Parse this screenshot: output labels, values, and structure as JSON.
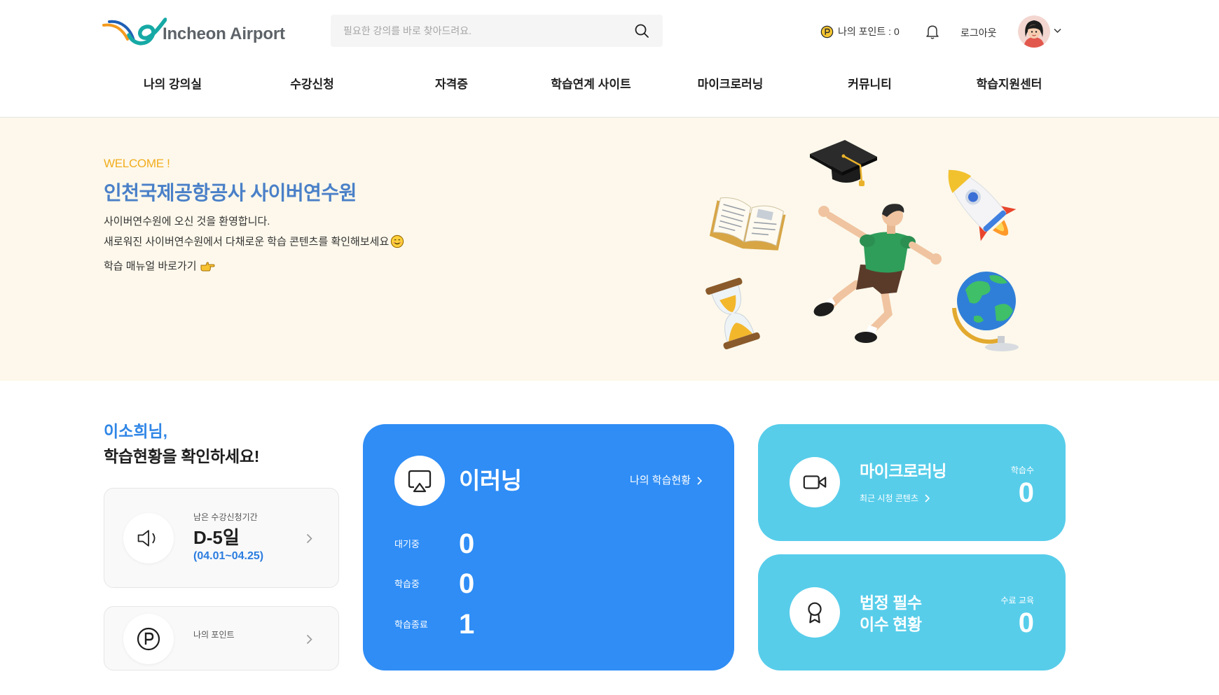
{
  "header": {
    "logo_text": "Incheon Airport",
    "search": {
      "placeholder": "필요한 강의를 바로 찾아드려요."
    },
    "points_label": "나의 포인트 : 0",
    "logout_label": "로그아웃"
  },
  "nav": {
    "items": [
      "나의 강의실",
      "수강신청",
      "자격증",
      "학습연계 사이트",
      "마이크로러닝",
      "커뮤니티",
      "학습지원센터"
    ]
  },
  "hero": {
    "welcome": "WELCOME !",
    "title": "인천국제공항공사 사이버연수원",
    "line1": "사이버연수원에 오신 것을 환영합니다.",
    "line2": "새로워진 사이버연수원에서 다채로운 학습 콘텐츠를 확인해보세요",
    "manual_link": "학습 매뉴얼 바로가기"
  },
  "status": {
    "greeting_name": "이소희님,",
    "greeting_text": "학습현황을 확인하세요!",
    "enrollment_period": {
      "label": "남은 수강신청기간",
      "dday": "D-5일",
      "range": "(04.01~04.25)"
    },
    "my_points": {
      "label": "나의 포인트"
    }
  },
  "elearning": {
    "title": "이러닝",
    "link": "나의 학습현황",
    "rows": [
      {
        "label": "대기중",
        "value": "0"
      },
      {
        "label": "학습중",
        "value": "0"
      },
      {
        "label": "학습종료",
        "value": "1"
      }
    ]
  },
  "microlearning": {
    "title": "마이크로러닝",
    "link": "최근 시청 콘텐츠",
    "stat_label": "학습수",
    "stat_value": "0"
  },
  "mandatory": {
    "title_line1": "법정 필수",
    "title_line2": "이수 현황",
    "stat_label": "수료 교육",
    "stat_value": "0"
  },
  "icons": {
    "logo": "incheon-airport-logo-icon",
    "search": "search-icon",
    "points": "point-coin-icon",
    "notifications": "bell-icon",
    "account_menu": "chevron-down-icon",
    "hero_emoji": "smile-emoji-icon",
    "manual_link": "pointing-hand-icon",
    "enrollment_period": "speaker-icon",
    "my_points": "point-circle-icon",
    "elearning": "airplay-icon",
    "microlearning": "video-camera-icon",
    "mandatory": "award-icon",
    "card_arrow": "chevron-right-icon",
    "illustrations": [
      "graduation-cap",
      "book",
      "student",
      "rocket",
      "hourglass",
      "globe"
    ]
  },
  "theme": {
    "hero_bg": "#fdf8eb",
    "accent_yellow": "#f2ad1e",
    "title_blue": "#4a80c8",
    "greeting_blue": "#2f86e6",
    "period_blue": "#2b7de0",
    "elearning_card": "#2f8df5",
    "micro_card": "#57cdea",
    "text_dark": "#1f1f1f"
  }
}
